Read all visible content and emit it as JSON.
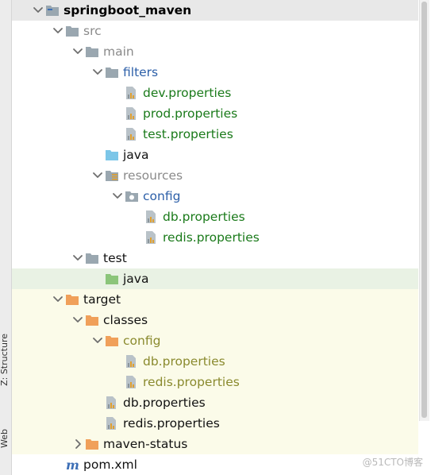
{
  "left_tabs": {
    "structure": "Z: Structure",
    "web": "Web"
  },
  "tree": {
    "rows": [
      {
        "label": "springboot_maven",
        "level": 0,
        "arrow": "down",
        "icon": "module-folder-icon",
        "color": "top",
        "bg": "sel-top"
      },
      {
        "label": "src",
        "level": 1,
        "arrow": "down",
        "icon": "folder-gray-icon",
        "color": "gray"
      },
      {
        "label": "main",
        "level": 2,
        "arrow": "down",
        "icon": "folder-gray-icon",
        "color": "gray"
      },
      {
        "label": "filters",
        "level": 3,
        "arrow": "down",
        "icon": "folder-gray-icon",
        "color": "blue"
      },
      {
        "label": "dev.properties",
        "level": 4,
        "arrow": "none",
        "icon": "properties-file-icon",
        "color": "green"
      },
      {
        "label": "prod.properties",
        "level": 4,
        "arrow": "none",
        "icon": "properties-file-icon",
        "color": "green"
      },
      {
        "label": "test.properties",
        "level": 4,
        "arrow": "none",
        "icon": "properties-file-icon",
        "color": "green"
      },
      {
        "label": "java",
        "level": 3,
        "arrow": "none",
        "icon": "source-folder-icon",
        "color": "black"
      },
      {
        "label": "resources",
        "level": 3,
        "arrow": "down",
        "icon": "resources-folder-icon",
        "color": "gray"
      },
      {
        "label": "config",
        "level": 4,
        "arrow": "down",
        "icon": "package-folder-icon",
        "color": "blue"
      },
      {
        "label": "db.properties",
        "level": 5,
        "arrow": "none",
        "icon": "properties-file-icon",
        "color": "green"
      },
      {
        "label": "redis.properties",
        "level": 5,
        "arrow": "none",
        "icon": "properties-file-icon",
        "color": "green"
      },
      {
        "label": "test",
        "level": 2,
        "arrow": "down",
        "icon": "folder-gray-icon",
        "color": "black"
      },
      {
        "label": "java",
        "level": 3,
        "arrow": "none",
        "icon": "test-source-folder-icon",
        "color": "black",
        "bg": "sel"
      },
      {
        "label": "target",
        "level": 1,
        "arrow": "down",
        "icon": "excluded-folder-icon",
        "color": "black",
        "bg": "tgt"
      },
      {
        "label": "classes",
        "level": 2,
        "arrow": "down",
        "icon": "excluded-folder-icon",
        "color": "black",
        "bg": "tgt"
      },
      {
        "label": "config",
        "level": 3,
        "arrow": "down",
        "icon": "excluded-folder-icon",
        "color": "olive",
        "bg": "tgt"
      },
      {
        "label": "db.properties",
        "level": 4,
        "arrow": "none",
        "icon": "properties-file-icon",
        "color": "olive",
        "bg": "tgt"
      },
      {
        "label": "redis.properties",
        "level": 4,
        "arrow": "none",
        "icon": "properties-file-icon",
        "color": "olive",
        "bg": "tgt"
      },
      {
        "label": "db.properties",
        "level": 3,
        "arrow": "none",
        "icon": "properties-file-icon",
        "color": "black",
        "bg": "tgt"
      },
      {
        "label": "redis.properties",
        "level": 3,
        "arrow": "none",
        "icon": "properties-file-icon",
        "color": "black",
        "bg": "tgt"
      },
      {
        "label": "maven-status",
        "level": 2,
        "arrow": "right",
        "icon": "excluded-folder-icon",
        "color": "black",
        "bg": "tgt"
      },
      {
        "label": "pom.xml",
        "level": 1,
        "arrow": "none",
        "icon": "maven-m-icon",
        "color": "black"
      }
    ]
  },
  "watermark": "@51CTO博客",
  "colors": {
    "folder_gray": "#9aa7b0",
    "folder_blue": "#7cc6e8",
    "folder_green": "#8bc57a",
    "folder_orange": "#f0a05a",
    "selection_bg": "#e9f2e4",
    "target_bg": "#fbfbe9"
  }
}
